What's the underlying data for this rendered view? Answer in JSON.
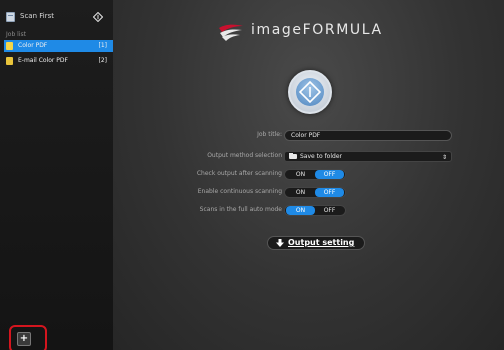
{
  "sidebar": {
    "app_title": "Scan First",
    "joblist_label": "Job list",
    "jobs": [
      {
        "label": "Color PDF",
        "num": "[1]",
        "selected": true
      },
      {
        "label": "E-mail Color PDF",
        "num": "[2]",
        "selected": false
      }
    ],
    "add_label": "+"
  },
  "main": {
    "brand": "imageFORMULA",
    "job_title_label": "Job title:",
    "job_title_value": "Color PDF",
    "output_method_label": "Output method selection",
    "output_method_value": "Save to folder",
    "check_output_label": "Check output after scanning",
    "continuous_label": "Enable continuous scanning",
    "full_auto_label": "Scans in the full auto mode",
    "on_label": "ON",
    "off_label": "OFF",
    "output_setting_label": "Output setting"
  },
  "colors": {
    "accent": "#1f8ae6",
    "highlight_red": "#d4151e"
  }
}
